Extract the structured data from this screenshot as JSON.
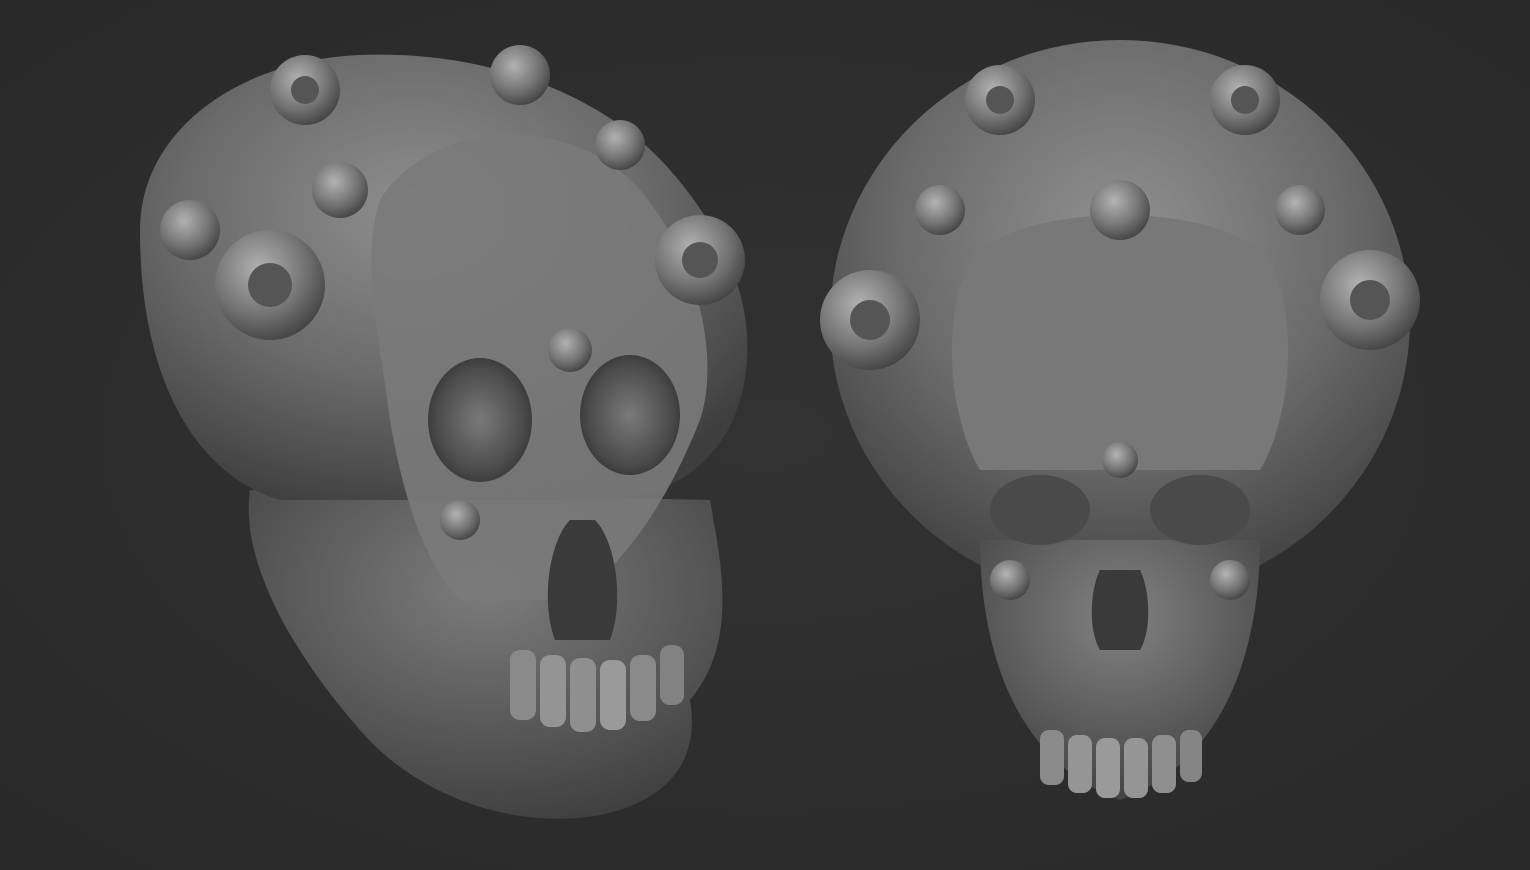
{
  "scene": {
    "background_color": "#2e2e2e",
    "material_colors": {
      "base": "#6a6a6a",
      "light": "#9a9a9a",
      "highlight": "#bdbdbd",
      "shadow": "#3c3c3c",
      "deep": "#262626"
    },
    "objects": [
      {
        "name": "ornate-ape-skull-three-quarter-view"
      },
      {
        "name": "ornate-ape-skull-front-view"
      }
    ]
  }
}
